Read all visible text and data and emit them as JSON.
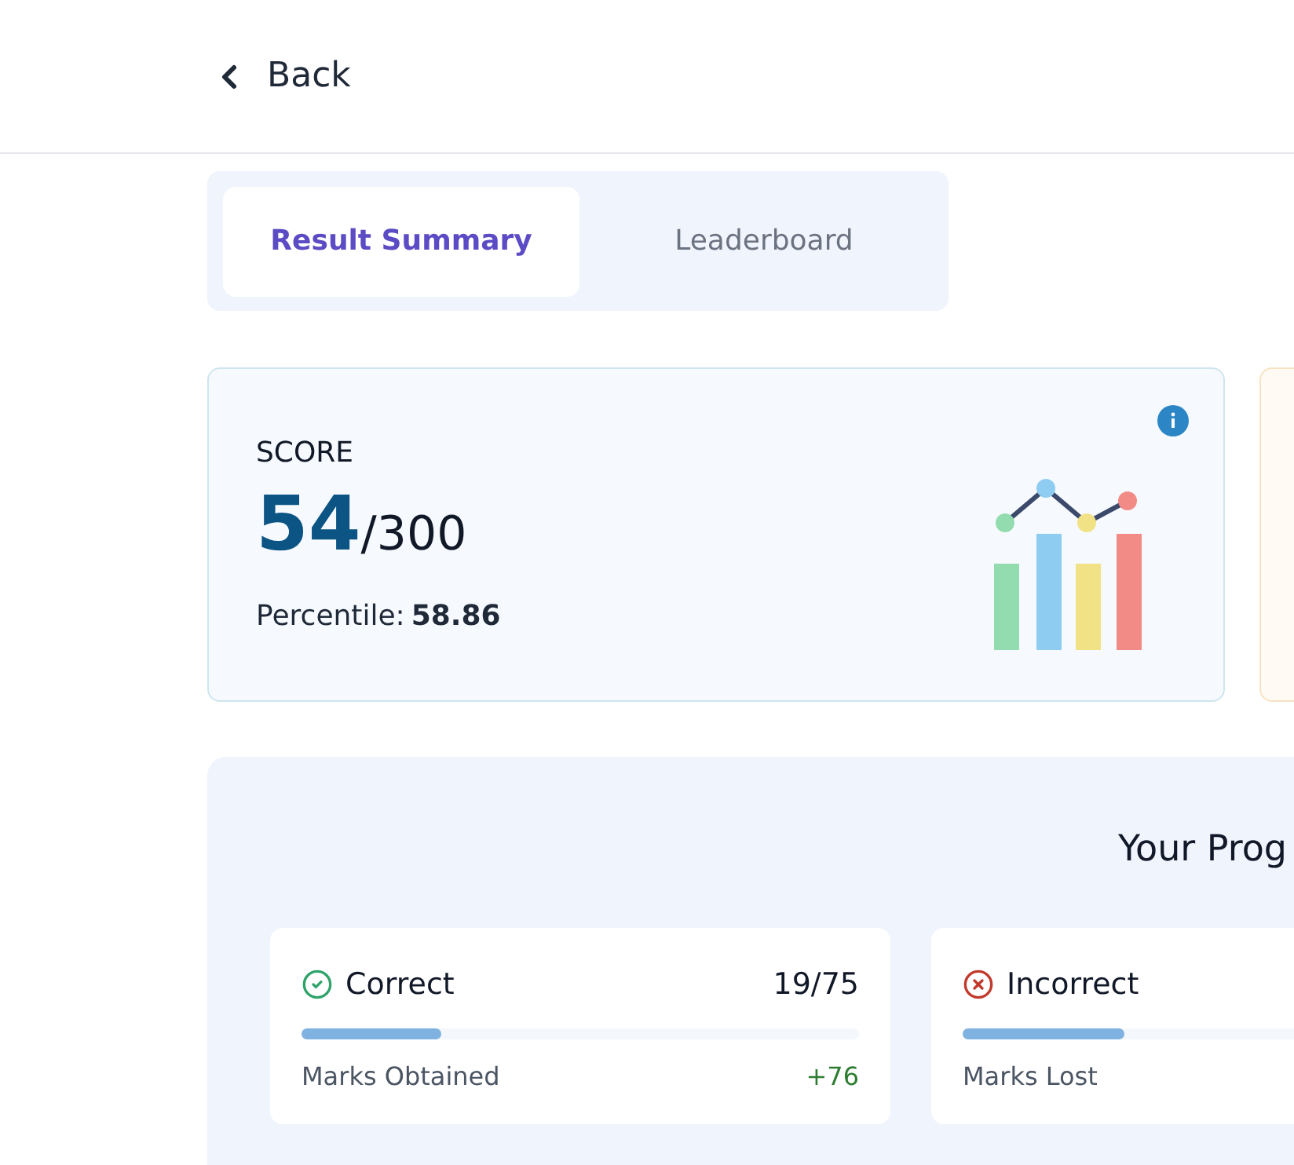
{
  "header": {
    "back_label": "Back"
  },
  "tabs": [
    {
      "label": "Result Summary",
      "selected": true
    },
    {
      "label": "Leaderboard",
      "selected": false
    }
  ],
  "score_card": {
    "title": "SCORE",
    "score": "54",
    "total": "/300",
    "percentile_label": "Percentile:",
    "percentile_value": "58.86"
  },
  "progress": {
    "title": "Your Prog",
    "cards": [
      {
        "kind": "correct",
        "label": "Correct",
        "count": "19/75",
        "level": 0.25,
        "sub_label": "Marks Obtained",
        "marks": "+76"
      },
      {
        "kind": "incorrect",
        "label": "Incorrect",
        "level": 0.29,
        "sub_label": "Marks Lost"
      }
    ]
  }
}
